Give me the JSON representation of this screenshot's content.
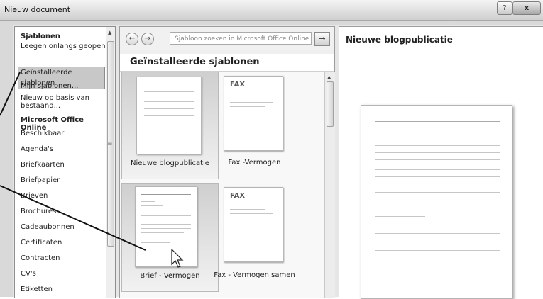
{
  "window": {
    "title": "Nieuw document",
    "help_label": "?",
    "close_label": "x"
  },
  "left_pane": {
    "items": [
      {
        "label": "Sjablonen",
        "kind": "head"
      },
      {
        "label": "Leegen onlangs geopend",
        "kind": "item"
      },
      {
        "label": "Geïnstalleerde sjablonen",
        "kind": "selected"
      },
      {
        "label": "Mijn sjablonen...",
        "kind": "item"
      },
      {
        "label": "Nieuw op basis van bestaand...",
        "kind": "item"
      },
      {
        "label": "Microsoft Office Online",
        "kind": "head"
      },
      {
        "label": "Beschikbaar",
        "kind": "item"
      },
      {
        "label": "Agenda's",
        "kind": "item"
      },
      {
        "label": "Briefkaarten",
        "kind": "item"
      },
      {
        "label": "Briefpapier",
        "kind": "item"
      },
      {
        "label": "Brieven",
        "kind": "item"
      },
      {
        "label": "Brochures",
        "kind": "item"
      },
      {
        "label": "Cadeaubonnen",
        "kind": "item"
      },
      {
        "label": "Certificaten",
        "kind": "item"
      },
      {
        "label": "Contracten",
        "kind": "item"
      },
      {
        "label": "CV's",
        "kind": "item"
      },
      {
        "label": "Etiketten",
        "kind": "item"
      }
    ]
  },
  "middle_pane": {
    "search_placeholder": "Sjabloon zoeken in Microsoft Office Online",
    "section_title": "Geïnstalleerde sjablonen",
    "templates": [
      {
        "label": "Nieuwe blogpublicatie",
        "kind": "blank",
        "selected": true
      },
      {
        "label": "Fax -Vermogen",
        "kind": "fax",
        "selected": false
      },
      {
        "label": "Brief - Vermogen",
        "kind": "letter",
        "selected": true
      },
      {
        "label": "Fax - Vermogen samen",
        "kind": "fax",
        "selected": false
      }
    ],
    "fax_word": "FAX"
  },
  "preview": {
    "title": "Nieuwe blogpublicatie"
  },
  "icons": {
    "back": "back-arrow-icon",
    "forward": "forward-arrow-icon",
    "go": "go-arrow-icon",
    "cursor": "mouse-pointer-icon"
  }
}
